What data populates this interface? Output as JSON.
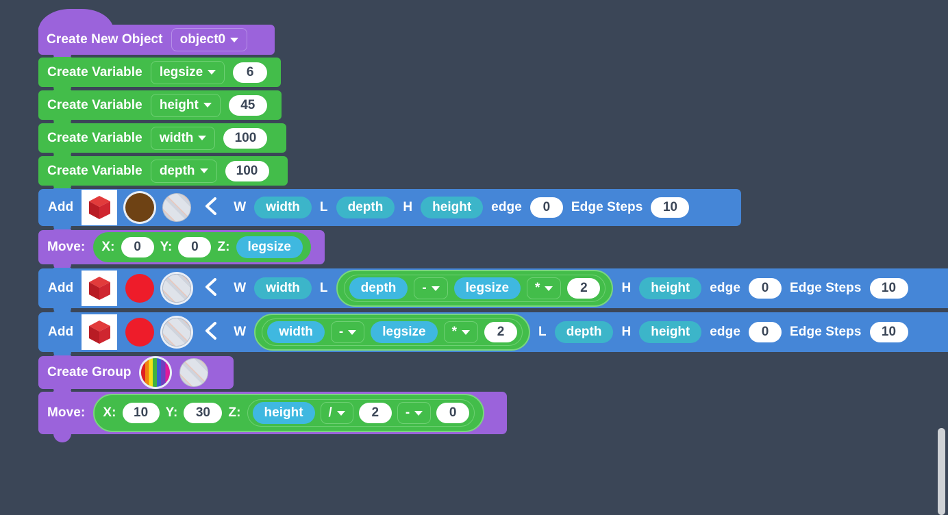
{
  "app": {
    "background_color": "#3b4657",
    "block_colors": {
      "control_purple": "#9B63DB",
      "variable_green": "#43BD4A",
      "shape_blue": "#4586D7",
      "variable_pill": "#3FB8E0",
      "field_white": "#FFFFFF"
    }
  },
  "scrollbar": {
    "visible": true
  },
  "blocks": [
    {
      "id": "create-new-object",
      "type": "hat",
      "color": "#9B63DB",
      "label": "Create New Object",
      "dropdown": {
        "value": "object0",
        "icon": "chevron-down-icon"
      }
    },
    {
      "id": "create-variable-legsize",
      "type": "statement",
      "color": "#43BD4A",
      "label": "Create Variable",
      "dropdown": {
        "value": "legsize",
        "icon": "chevron-down-icon"
      },
      "value": "6"
    },
    {
      "id": "create-variable-height",
      "type": "statement",
      "color": "#43BD4A",
      "label": "Create Variable",
      "dropdown": {
        "value": "height",
        "icon": "chevron-down-icon"
      },
      "value": "45"
    },
    {
      "id": "create-variable-width",
      "type": "statement",
      "color": "#43BD4A",
      "label": "Create Variable",
      "dropdown": {
        "value": "width",
        "icon": "chevron-down-icon"
      },
      "value": "100"
    },
    {
      "id": "create-variable-depth",
      "type": "statement",
      "color": "#43BD4A",
      "label": "Create Variable",
      "dropdown": {
        "value": "depth",
        "icon": "chevron-down-icon"
      },
      "value": "100"
    },
    {
      "id": "add-block-1",
      "type": "add",
      "color": "#4586D7",
      "label": "Add",
      "shape_icon": "red-cube-icon",
      "color_swatch": {
        "name": "brown-color-swatch",
        "hex": "#6E4214",
        "selected": true
      },
      "texture_swatch": {
        "name": "striped-texture-swatch",
        "selected": false
      },
      "collapse_icon": "chevron-left-icon",
      "fields": {
        "w_label": "W",
        "w_value": "width",
        "l_label": "L",
        "l_value": "depth",
        "h_label": "H",
        "h_value": "height",
        "edge_label": "edge",
        "edge_value": "0",
        "edge_steps_label": "Edge Steps",
        "edge_steps_value": "10"
      }
    },
    {
      "id": "move-block-1",
      "type": "move",
      "color": "#9B63DB",
      "label": "Move:",
      "x_label": "X:",
      "x_value": "0",
      "y_label": "Y:",
      "y_value": "0",
      "z_label": "Z:",
      "z_value": "legsize"
    },
    {
      "id": "add-block-2",
      "type": "add",
      "color": "#4586D7",
      "label": "Add",
      "shape_icon": "red-cube-icon",
      "color_swatch": {
        "name": "red-color-swatch",
        "hex": "#EE1C2A",
        "selected": false
      },
      "texture_swatch": {
        "name": "striped-texture-swatch",
        "selected": true
      },
      "collapse_icon": "chevron-left-icon",
      "fields": {
        "w_label": "W",
        "w_value": "width",
        "l_label": "L",
        "l_expression": {
          "operand1": "depth",
          "operator1": "-",
          "operand2": "legsize",
          "operator2": "*",
          "operand3": "2"
        },
        "h_label": "H",
        "h_value": "height",
        "edge_label": "edge",
        "edge_value": "0",
        "edge_steps_label": "Edge Steps",
        "edge_steps_value": "10"
      }
    },
    {
      "id": "add-block-3",
      "type": "add",
      "color": "#4586D7",
      "label": "Add",
      "shape_icon": "red-cube-icon",
      "color_swatch": {
        "name": "red-color-swatch",
        "hex": "#EE1C2A",
        "selected": false
      },
      "texture_swatch": {
        "name": "striped-texture-swatch",
        "selected": true
      },
      "collapse_icon": "chevron-left-icon",
      "fields": {
        "w_label": "W",
        "w_expression": {
          "operand1": "width",
          "operator1": "-",
          "operand2": "legsize",
          "operator2": "*",
          "operand3": "2"
        },
        "l_label": "L",
        "l_value": "depth",
        "h_label": "H",
        "h_value": "height",
        "edge_label": "edge",
        "edge_value": "0",
        "edge_steps_label": "Edge Steps",
        "edge_steps_value": "10"
      }
    },
    {
      "id": "create-group",
      "type": "statement",
      "color": "#9B63DB",
      "label": "Create Group",
      "color_swatch": {
        "name": "rainbow-color-swatch",
        "selected": true
      },
      "texture_swatch": {
        "name": "striped-texture-swatch",
        "selected": false
      }
    },
    {
      "id": "move-block-2",
      "type": "move",
      "color": "#9B63DB",
      "label": "Move:",
      "x_label": "X:",
      "x_value": "10",
      "y_label": "Y:",
      "y_value": "30",
      "z_label": "Z:",
      "z_expression": {
        "operand1": "height",
        "operator1": "/",
        "operand2": "2",
        "operator2": "-",
        "operand3": "0"
      }
    }
  ]
}
